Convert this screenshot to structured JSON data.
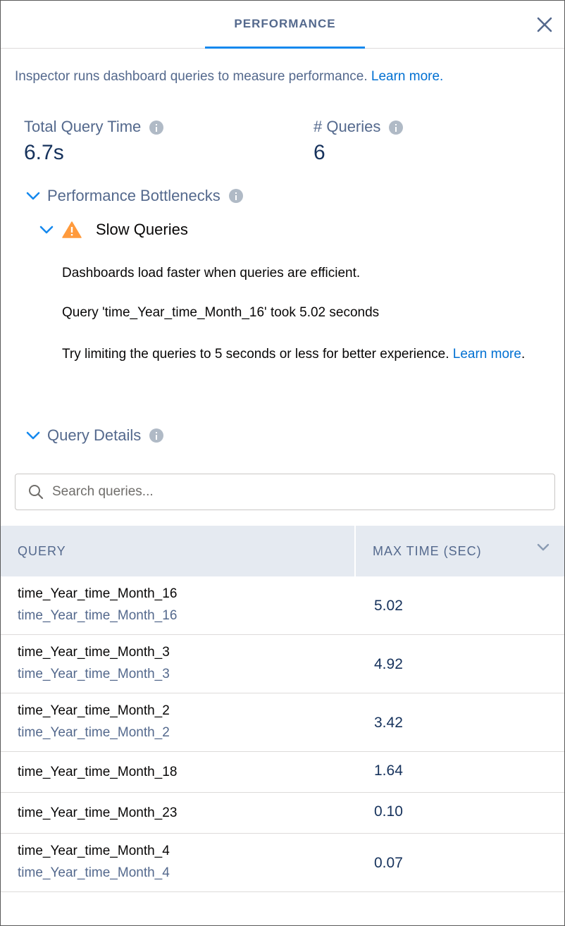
{
  "header": {
    "tab_label": "PERFORMANCE"
  },
  "intro": {
    "text": "Inspector runs dashboard queries to measure performance. ",
    "link": "Learn more."
  },
  "stats": {
    "total_query_time_label": "Total Query Time",
    "total_query_time_value": "6.7s",
    "queries_label": "# Queries",
    "queries_value": "6"
  },
  "bottlenecks": {
    "title": "Performance Bottlenecks",
    "slow_queries": {
      "title": "Slow Queries",
      "line1": "Dashboards load faster when queries are efficient.",
      "line2": "Query 'time_Year_time_Month_16' took 5.02 seconds",
      "line3": "Try limiting the queries to 5 seconds or less for better experience. ",
      "link": "Learn more",
      "period": "."
    }
  },
  "query_details": {
    "title": "Query Details"
  },
  "search": {
    "placeholder": "Search queries..."
  },
  "table": {
    "columns": [
      "QUERY",
      "MAX TIME (SEC)"
    ],
    "rows": [
      {
        "name": "time_Year_time_Month_16",
        "sub": "time_Year_time_Month_16",
        "time": "5.02"
      },
      {
        "name": "time_Year_time_Month_3",
        "sub": "time_Year_time_Month_3",
        "time": "4.92"
      },
      {
        "name": "time_Year_time_Month_2",
        "sub": "time_Year_time_Month_2",
        "time": "3.42"
      },
      {
        "name": "time_Year_time_Month_18",
        "sub": "",
        "time": "1.64"
      },
      {
        "name": "time_Year_time_Month_23",
        "sub": "",
        "time": "0.10"
      },
      {
        "name": "time_Year_time_Month_4",
        "sub": "time_Year_time_Month_4",
        "time": "0.07"
      }
    ]
  },
  "colors": {
    "accent": "#1589ee",
    "link": "#0070d2",
    "warning": "#ff9a3c",
    "header_bg": "#e5eaf1"
  },
  "icons": [
    "close-icon",
    "info-icon",
    "chevron-down-icon",
    "warning-icon",
    "search-icon"
  ]
}
